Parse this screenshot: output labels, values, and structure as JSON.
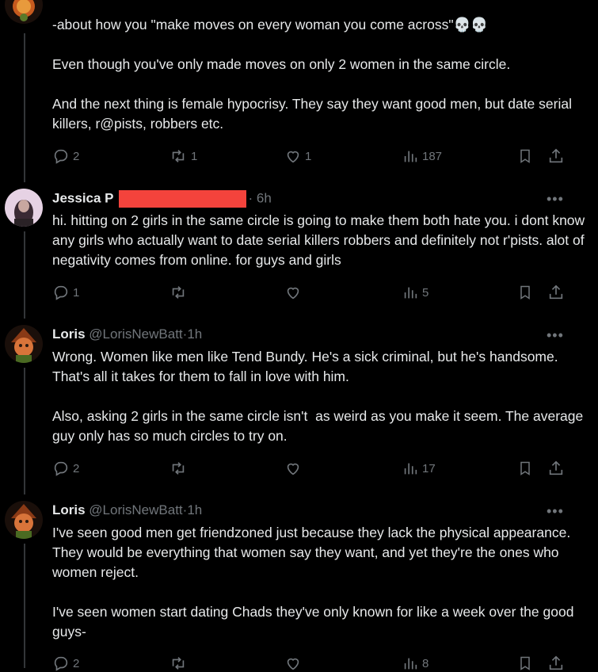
{
  "posts": [
    {
      "id": "post-0",
      "text": "-about how you \"make moves on every woman you come across\"💀💀\n\nEven though you've only made moves on only 2 women in the same circle.\n\nAnd the next thing is female hypocrisy. They say they want good men, but date serial killers, r@pists, robbers etc.",
      "replies": "2",
      "reposts": "1",
      "likes": "1",
      "views": "187"
    },
    {
      "id": "post-1",
      "name": "Jessica P",
      "dot": "·",
      "time": "6h",
      "text": "hi. hitting on 2 girls in the same circle is going to make them both hate you. i dont know any girls who actually want to date serial killers robbers and definitely not r'pists. alot of negativity comes from online. for guys and girls",
      "replies": "1",
      "reposts": "",
      "likes": "",
      "views": "5"
    },
    {
      "id": "post-2",
      "name": "Loris",
      "handle": "@LorisNewBatt",
      "dot": "·",
      "time": "1h",
      "text": "Wrong. Women like men like Tend Bundy. He's a sick criminal, but he's handsome. That's all it takes for them to fall in love with him.\n\nAlso, asking 2 girls in the same circle isn't  as weird as you make it seem. The average guy only has so much circles to try on.",
      "replies": "2",
      "reposts": "",
      "likes": "",
      "views": "17"
    },
    {
      "id": "post-3",
      "name": "Loris",
      "handle": "@LorisNewBatt",
      "dot": "·",
      "time": "1h",
      "text": "I've seen good men get friendzoned just because they lack the physical appearance. They would be everything that women say they want, and yet they're the ones who women reject.\n\nI've seen women start dating Chads they've only known for like a week over the good guys-",
      "replies": "2",
      "reposts": "",
      "likes": "",
      "views": "8"
    }
  ],
  "more_label": "•••",
  "colors": {
    "background": "#000000",
    "text": "#e7e9ea",
    "muted": "#71767b",
    "thread_line": "#333639",
    "redaction": "#f4433c"
  },
  "icons": [
    "reply-icon",
    "repost-icon",
    "like-icon",
    "views-icon",
    "bookmark-icon",
    "share-icon",
    "more-icon"
  ]
}
